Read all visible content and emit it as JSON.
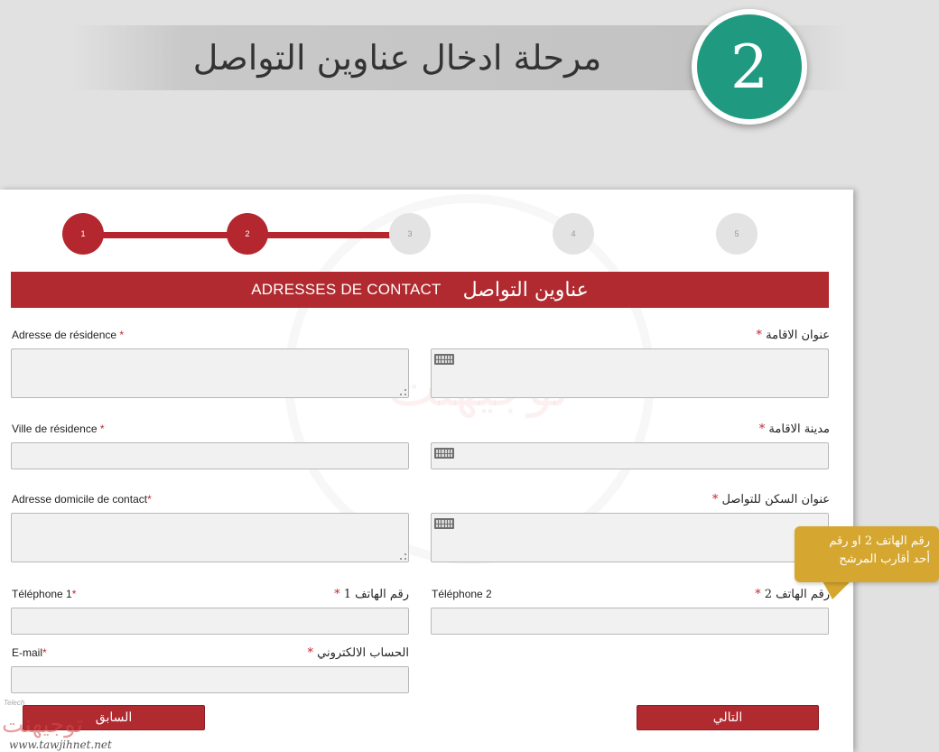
{
  "header": {
    "title": "مرحلة ادخال عناوين التواصل",
    "step_number": "2"
  },
  "stepper": {
    "steps": [
      "1",
      "2",
      "3",
      "4",
      "5"
    ],
    "current": 2
  },
  "section": {
    "title_fr": "ADRESSES DE CONTACT",
    "title_ar": "عناوين التواصل"
  },
  "form": {
    "residence_address": {
      "label_fr": "Adresse de résidence",
      "label_ar": "عنوان الاقامة",
      "req": "*"
    },
    "residence_city": {
      "label_fr": "Ville de résidence",
      "label_ar": "مدينة الاقامة",
      "req": "*"
    },
    "contact_address": {
      "label_fr": "Adresse domicile de contact",
      "label_ar": "عنوان السكن للتواصل",
      "req": "*"
    },
    "phone1": {
      "label_fr": "Téléphone 1",
      "label_ar": "رقم الهاتف 1",
      "req": "*"
    },
    "phone2": {
      "label_fr": "Téléphone 2",
      "label_ar": "رقم الهاتف 2",
      "req": "*"
    },
    "email": {
      "label_fr": "E-mail",
      "label_ar": "الحساب الالكتروني",
      "req": "*"
    }
  },
  "buttons": {
    "previous": "السابق",
    "next": "التالي"
  },
  "callout": {
    "line1": "رقم الهاتف 2 او رقم",
    "line2": "أحد أقارب المرشح"
  },
  "watermark": {
    "small": "Telech",
    "logo": "توجيهنت",
    "url": "www.tawjihnet.net"
  },
  "colors": {
    "accent_red": "#b02a2f",
    "teal": "#1f9a80",
    "callout_gold": "#d6a730"
  }
}
